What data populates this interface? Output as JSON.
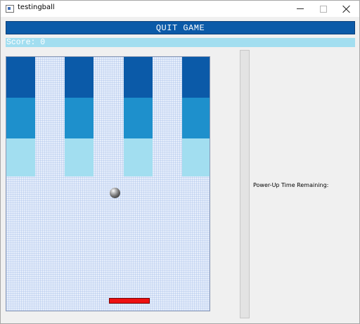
{
  "window": {
    "title": "testingball",
    "minimize_icon": "minimize-icon",
    "maximize_icon": "maximize-icon",
    "close_icon": "close-icon"
  },
  "controls": {
    "quit_label": "QUIT GAME",
    "score_text": "Score: 0"
  },
  "powerup": {
    "label": "Power-Up Time Remaining:",
    "remaining_fraction": 0
  },
  "colors": {
    "brick_row_1": "#0b5aa8",
    "brick_row_2": "#1e90cc",
    "brick_row_3": "#a2def0",
    "paddle": "#ee1111",
    "quit_button": "#0b5aa8",
    "score_bar": "#a2def0"
  },
  "bricks": {
    "rows": 3,
    "columns": 4
  }
}
